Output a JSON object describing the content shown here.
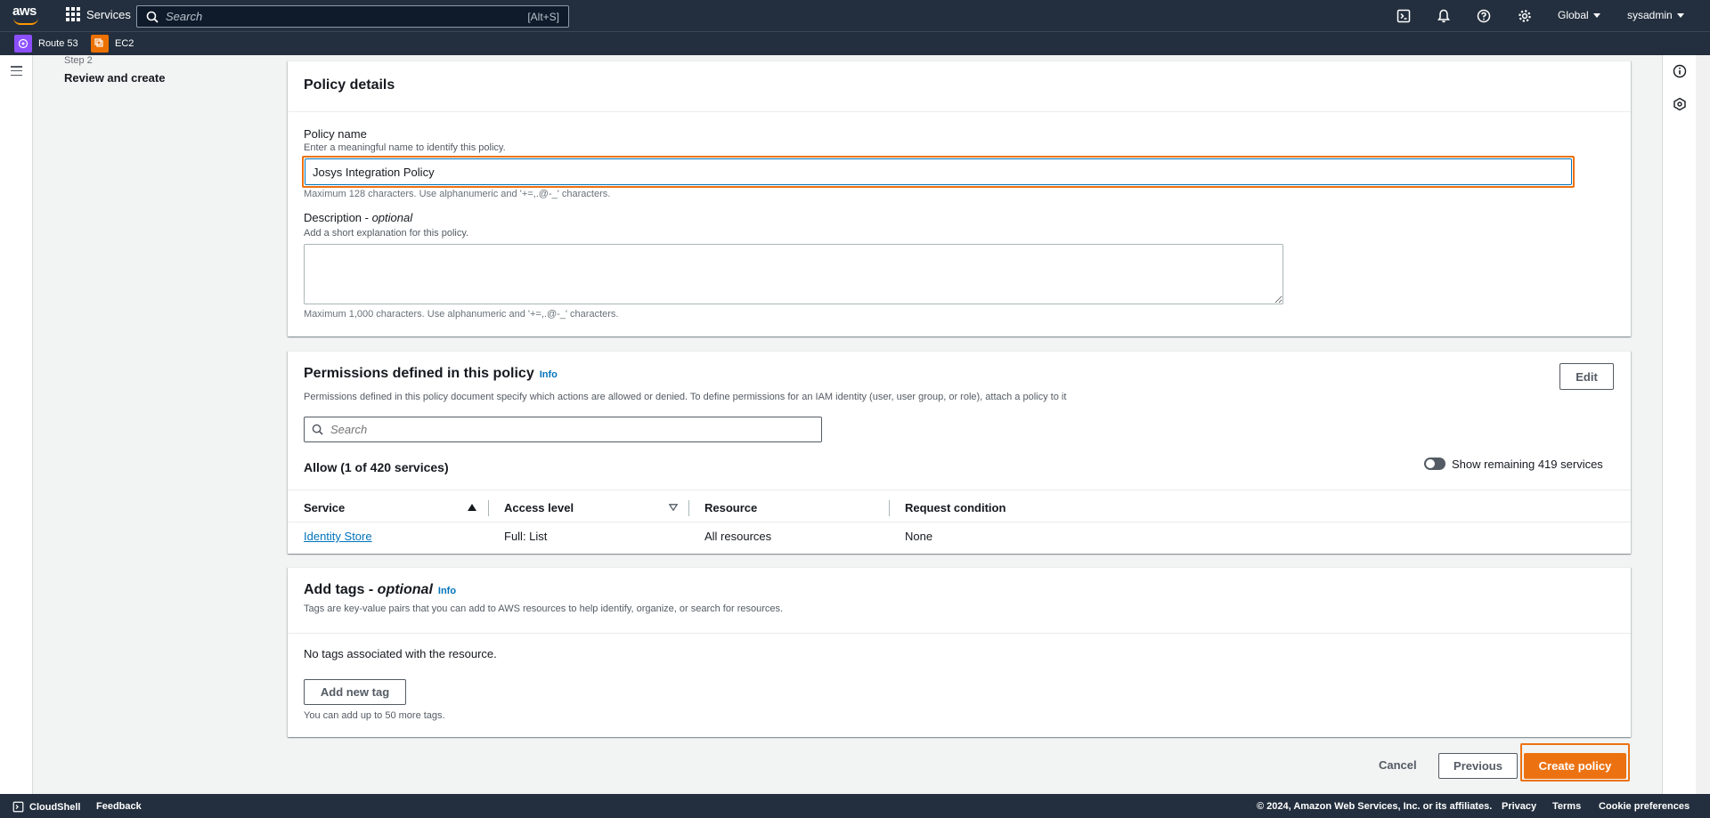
{
  "topnav": {
    "logo_text": "aws",
    "services_label": "Services",
    "search_placeholder": "Search",
    "search_shortcut": "[Alt+S]",
    "region_label": "Global",
    "user_label": "sysadmin",
    "icons": [
      "cloudshell-icon",
      "bell-icon",
      "help-icon",
      "gear-icon"
    ]
  },
  "favorites": [
    {
      "label": "Route 53",
      "color": "#8c4fff"
    },
    {
      "label": "EC2",
      "color": "#ed7100"
    }
  ],
  "steps": {
    "step_label": "Step 2",
    "step_title": "Review and create"
  },
  "policy_details": {
    "title": "Policy details",
    "name_label": "Policy name",
    "name_hint": "Enter a meaningful name to identify this policy.",
    "name_value": "Josys Integration Policy",
    "name_constraint": "Maximum 128 characters. Use alphanumeric and '+=,.@-_' characters.",
    "description_label": "Description - ",
    "description_optional": "optional",
    "description_hint": "Add a short explanation for this policy.",
    "description_value": "",
    "description_constraint": "Maximum 1,000 characters. Use alphanumeric and '+=,.@-_' characters."
  },
  "permissions": {
    "title": "Permissions defined in this policy",
    "info": "Info",
    "edit_label": "Edit",
    "description": "Permissions defined in this policy document specify which actions are allowed or denied. To define permissions for an IAM identity (user, user group, or role), attach a policy to it",
    "search_placeholder": "Search",
    "allow_heading": "Allow (1 of 420 services)",
    "toggle_label": "Show remaining 419 services",
    "columns": [
      "Service",
      "Access level",
      "Resource",
      "Request condition"
    ],
    "rows": [
      {
        "service": "Identity Store",
        "access_level": "Full: List",
        "resource": "All resources",
        "condition": "None"
      }
    ]
  },
  "tags": {
    "title": "Add tags - ",
    "title_optional": "optional",
    "info": "Info",
    "description": "Tags are key-value pairs that you can add to AWS resources to help identify, organize, or search for resources.",
    "empty": "No tags associated with the resource.",
    "add_button": "Add new tag",
    "limit": "You can add up to 50 more tags."
  },
  "actions": {
    "cancel": "Cancel",
    "previous": "Previous",
    "create": "Create policy"
  },
  "footer": {
    "cloudshell": "CloudShell",
    "feedback": "Feedback",
    "copyright": "© 2024, Amazon Web Services, Inc. or its affiliates.",
    "privacy": "Privacy",
    "terms": "Terms",
    "cookies": "Cookie preferences"
  }
}
